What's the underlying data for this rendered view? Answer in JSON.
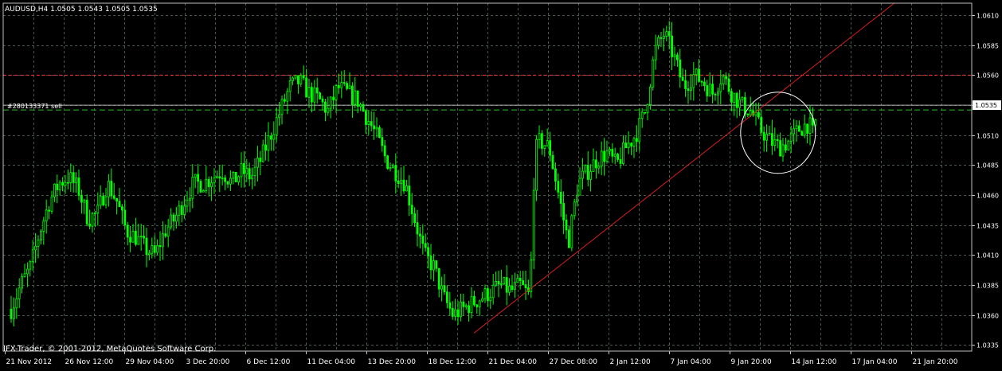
{
  "header": {
    "symbol_line": "AUDUSD,H4  1.0505 1.0543 1.0505 1.0535"
  },
  "order_label": "#280133371 sell",
  "footer": {
    "copyright": "IFX-Trader, © 2001-2012, MetaQuotes Software Corp."
  },
  "colors": {
    "background": "#000000",
    "grid": "#4a5a4a",
    "axis": "#c0c0c0",
    "bull_candle": "#00ff00",
    "bear_candle": "#00ff00",
    "trendline": "#d81f1f",
    "level_line": "#ff3030",
    "order_line": "#20c020",
    "circle": "#ffffff",
    "price_box_bg": "#ffffff",
    "price_box_fg": "#000000"
  },
  "chart_data": {
    "type": "candlestick",
    "title": "AUDUSD,H4",
    "ylim": [
      1.033,
      1.062
    ],
    "grid": true,
    "current_price": "1.0535",
    "y_ticks": [
      "1.0610",
      "1.0585",
      "1.0560",
      "1.0535",
      "1.0510",
      "1.0485",
      "1.0460",
      "1.0435",
      "1.0410",
      "1.0385",
      "1.0360",
      "1.0335"
    ],
    "x_ticks": [
      "21 Nov 2012",
      "26 Nov 12:00",
      "29 Nov 04:00",
      "3 Dec 20:00",
      "6 Dec 12:00",
      "11 Dec 04:00",
      "13 Dec 20:00",
      "18 Dec 12:00",
      "21 Dec 04:00",
      "27 Dec 08:00",
      "2 Jan 12:00",
      "7 Jan 04:00",
      "9 Jan 20:00",
      "14 Jan 12:00",
      "17 Jan 04:00",
      "21 Jan 20:00"
    ],
    "close_path": [
      [
        0,
        1.0365
      ],
      [
        0.01,
        1.0385
      ],
      [
        0.02,
        1.04
      ],
      [
        0.03,
        1.043
      ],
      [
        0.04,
        1.0455
      ],
      [
        0.05,
        1.047
      ],
      [
        0.06,
        1.0475
      ],
      [
        0.07,
        1.0465
      ],
      [
        0.08,
        1.044
      ],
      [
        0.09,
        1.0445
      ],
      [
        0.1,
        1.047
      ],
      [
        0.11,
        1.0455
      ],
      [
        0.12,
        1.043
      ],
      [
        0.13,
        1.0425
      ],
      [
        0.14,
        1.0415
      ],
      [
        0.15,
        1.041
      ],
      [
        0.16,
        1.043
      ],
      [
        0.17,
        1.044
      ],
      [
        0.18,
        1.0455
      ],
      [
        0.19,
        1.047
      ],
      [
        0.2,
        1.047
      ],
      [
        0.21,
        1.0475
      ],
      [
        0.22,
        1.048
      ],
      [
        0.23,
        1.047
      ],
      [
        0.24,
        1.048
      ],
      [
        0.25,
        1.0475
      ],
      [
        0.26,
        1.049
      ],
      [
        0.27,
        1.051
      ],
      [
        0.28,
        1.053
      ],
      [
        0.29,
        1.055
      ],
      [
        0.3,
        1.0555
      ],
      [
        0.31,
        1.0545
      ],
      [
        0.32,
        1.054
      ],
      [
        0.33,
        1.053
      ],
      [
        0.34,
        1.055
      ],
      [
        0.35,
        1.0545
      ],
      [
        0.36,
        1.054
      ],
      [
        0.37,
        1.0525
      ],
      [
        0.38,
        1.051
      ],
      [
        0.39,
        1.049
      ],
      [
        0.4,
        1.048
      ],
      [
        0.41,
        1.047
      ],
      [
        0.42,
        1.044
      ],
      [
        0.43,
        1.041
      ],
      [
        0.44,
        1.04
      ],
      [
        0.45,
        1.0375
      ],
      [
        0.46,
        1.036
      ],
      [
        0.47,
        1.0365
      ],
      [
        0.48,
        1.037
      ],
      [
        0.49,
        1.0375
      ],
      [
        0.5,
        1.038
      ],
      [
        0.51,
        1.0385
      ],
      [
        0.52,
        1.038
      ],
      [
        0.53,
        1.0385
      ],
      [
        0.54,
        1.0375
      ],
      [
        0.545,
        1.0495
      ],
      [
        0.55,
        1.0505
      ],
      [
        0.56,
        1.05
      ],
      [
        0.57,
        1.046
      ],
      [
        0.58,
        1.042
      ],
      [
        0.59,
        1.047
      ],
      [
        0.6,
        1.048
      ],
      [
        0.61,
        1.049
      ],
      [
        0.62,
        1.0495
      ],
      [
        0.63,
        1.0485
      ],
      [
        0.64,
        1.05
      ],
      [
        0.65,
        1.051
      ],
      [
        0.66,
        1.053
      ],
      [
        0.67,
        1.058
      ],
      [
        0.68,
        1.0595
      ],
      [
        0.69,
        1.0575
      ],
      [
        0.7,
        1.055
      ],
      [
        0.71,
        1.056
      ],
      [
        0.72,
        1.0555
      ],
      [
        0.73,
        1.0545
      ],
      [
        0.74,
        1.056
      ],
      [
        0.75,
        1.0545
      ],
      [
        0.76,
        1.0535
      ],
      [
        0.77,
        1.053
      ],
      [
        0.78,
        1.0515
      ],
      [
        0.79,
        1.0505
      ],
      [
        0.8,
        1.05
      ],
      [
        0.81,
        1.0505
      ],
      [
        0.82,
        1.0515
      ],
      [
        0.83,
        1.052
      ],
      [
        0.835,
        1.051
      ],
      [
        0.84,
        1.0535
      ]
    ]
  }
}
